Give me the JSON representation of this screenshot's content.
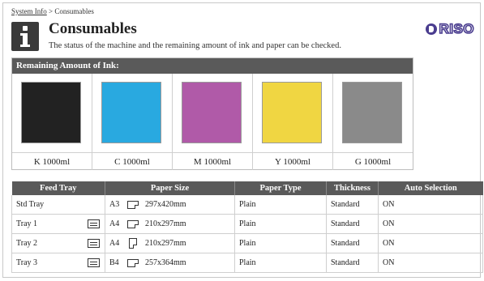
{
  "breadcrumb": {
    "root": "System Info",
    "separator": " > ",
    "current": "Consumables"
  },
  "header": {
    "title": "Consumables",
    "description": "The status of the machine and the remaining amount of ink and paper can be checked.",
    "logo_text": "RISO",
    "logo_color": "#4a3d8f"
  },
  "ink": {
    "heading": "Remaining Amount of Ink:",
    "items": [
      {
        "label": "K 1000ml",
        "color": "#222222"
      },
      {
        "label": "C 1000ml",
        "color": "#29a9e0"
      },
      {
        "label": "M 1000ml",
        "color": "#b05aa8"
      },
      {
        "label": "Y 1000ml",
        "color": "#f0d642"
      },
      {
        "label": "G  1000ml",
        "color": "#8a8a8a"
      }
    ]
  },
  "trays": {
    "columns": [
      "Feed Tray",
      "Paper Size",
      "Paper Type",
      "Thickness",
      "Auto Selection"
    ],
    "rows": [
      {
        "feed": "Std Tray",
        "tray_icon": false,
        "size_code": "A3",
        "orientation": "landscape",
        "size": "297x420mm",
        "type": "Plain",
        "thickness": "Standard",
        "auto": "ON"
      },
      {
        "feed": "Tray 1",
        "tray_icon": true,
        "size_code": "A4",
        "orientation": "landscape",
        "size": "210x297mm",
        "type": "Plain",
        "thickness": "Standard",
        "auto": "ON"
      },
      {
        "feed": "Tray 2",
        "tray_icon": true,
        "size_code": "A4",
        "orientation": "portrait",
        "size": "210x297mm",
        "type": "Plain",
        "thickness": "Standard",
        "auto": "ON"
      },
      {
        "feed": "Tray 3",
        "tray_icon": true,
        "size_code": "B4",
        "orientation": "landscape",
        "size": "257x364mm",
        "type": "Plain",
        "thickness": "Standard",
        "auto": "ON"
      }
    ]
  }
}
